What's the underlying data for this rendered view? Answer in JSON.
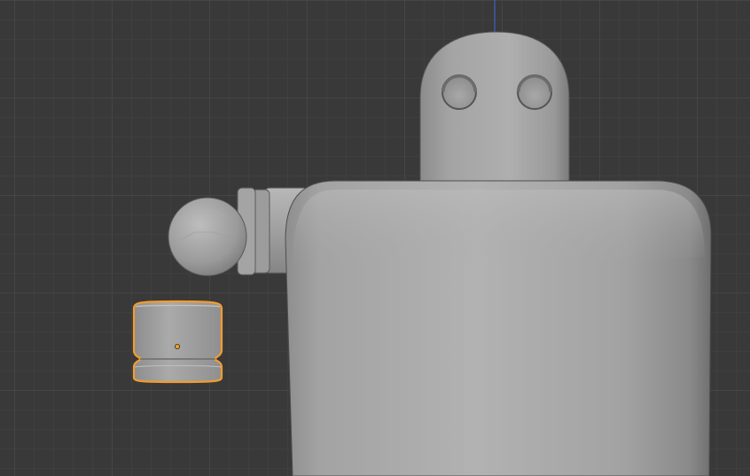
{
  "viewport": {
    "background": "#393939",
    "grid_major": "#454545",
    "grid_minor": "#3f3f3f",
    "axis_z_color": "#3d62c9",
    "selection_outline": "#f29c2e",
    "origin_point": "#f0a030",
    "mesh_color": "#a8a8a8"
  },
  "objects": [
    {
      "name": "robot-head",
      "selected": false
    },
    {
      "name": "robot-eye-left",
      "selected": false
    },
    {
      "name": "robot-eye-right",
      "selected": false
    },
    {
      "name": "robot-body",
      "selected": false
    },
    {
      "name": "robot-shoulder-joint",
      "selected": false
    },
    {
      "name": "robot-hand-sphere",
      "selected": false
    },
    {
      "name": "cylinder-part",
      "selected": true
    }
  ]
}
